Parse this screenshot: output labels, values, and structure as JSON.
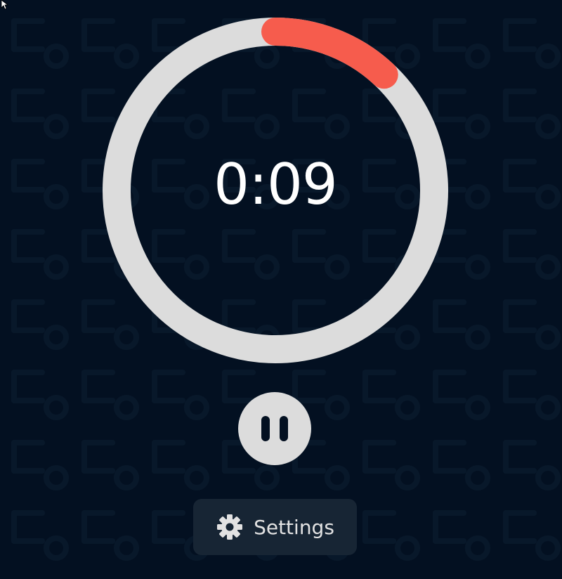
{
  "timer": {
    "time": "0:09",
    "progress_fraction": 0.12
  },
  "controls": {
    "pause_icon": "pause-icon"
  },
  "settings": {
    "label": "Settings",
    "icon": "gear-icon"
  },
  "colors": {
    "background": "#031021",
    "ring_track": "#dcdcdc",
    "ring_progress": "#f65c4d",
    "button": "#dcdcdc",
    "settings_bg": "#172534",
    "text": "#ffffff"
  }
}
